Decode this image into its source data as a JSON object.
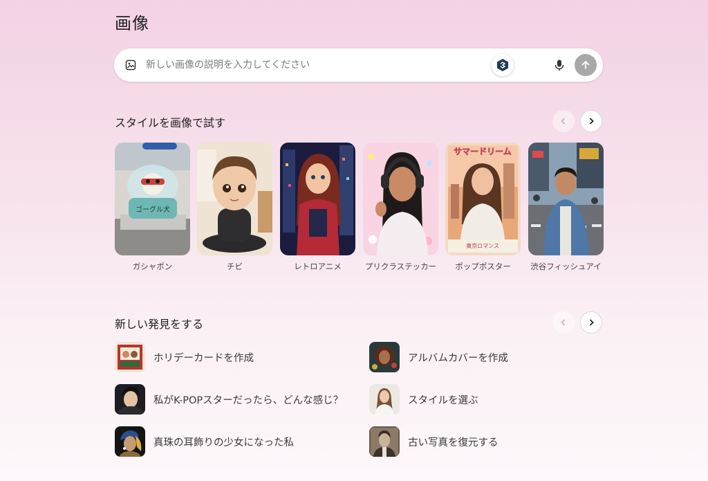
{
  "page": {
    "title": "画像"
  },
  "prompt": {
    "placeholder": "新しい画像の説明を入力してください"
  },
  "styles_section": {
    "title": "スタイルを画像で試す",
    "items": [
      {
        "label": "ガシャポン",
        "thumb_text": "ゴーグル犬"
      },
      {
        "label": "チビ"
      },
      {
        "label": "レトロアニメ"
      },
      {
        "label": "プリクラステッカー"
      },
      {
        "label": "ポップポスター",
        "thumb_text": "サマードリーム",
        "thumb_subtext": "東京ロマンス"
      },
      {
        "label": "渋谷フィッシュアイ"
      }
    ]
  },
  "discover_section": {
    "title": "新しい発見をする",
    "items": [
      {
        "label": "ホリデーカードを作成"
      },
      {
        "label": "アルバムカバーを作成"
      },
      {
        "label": "私がK-POPスターだったら、どんな感じ？"
      },
      {
        "label": "スタイルを選ぶ"
      },
      {
        "label": "真珠の耳飾りの少女になった私"
      },
      {
        "label": "古い写真を復元する"
      }
    ]
  },
  "colors": {
    "accent": "#1f3b57",
    "send_disabled": "#a8a8a8"
  }
}
